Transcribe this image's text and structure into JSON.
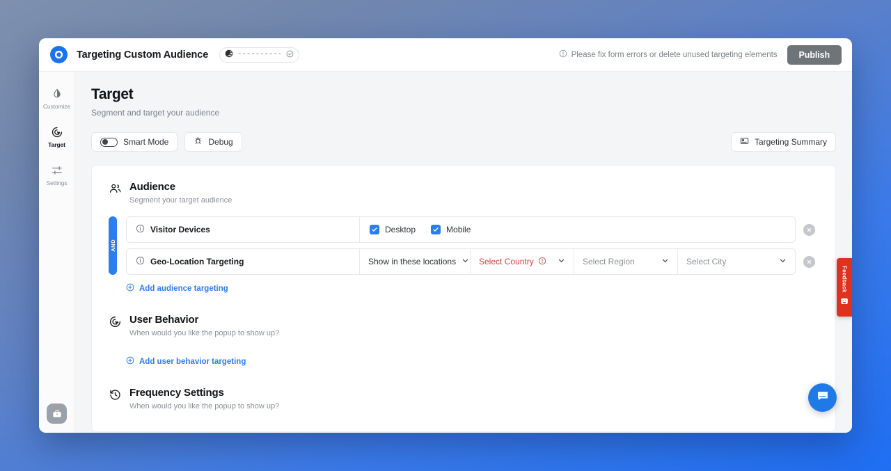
{
  "topbar": {
    "logo_icon": "brand-logo-icon",
    "app_title": "Targeting Custom Audience",
    "status_pill": {
      "globe_icon": "globe-icon",
      "dashes": "----------",
      "check_icon": "check-circle-icon"
    },
    "form_error": {
      "icon": "alert-circle-icon",
      "text": "Please fix form errors or delete unused targeting elements"
    },
    "publish_label": "Publish"
  },
  "sidebar": {
    "items": [
      {
        "label": "Customize",
        "icon": "contrast-droplet-icon",
        "active": false
      },
      {
        "label": "Target",
        "icon": "target-cursor-icon",
        "active": true
      },
      {
        "label": "Settings",
        "icon": "sliders-icon",
        "active": false
      }
    ],
    "bottom_button_icon": "briefcase-icon"
  },
  "page": {
    "title": "Target",
    "subtitle": "Segment and target your audience"
  },
  "toolbar": {
    "smart_mode_label": "Smart Mode",
    "smart_mode_on": false,
    "debug_label": "Debug",
    "debug_icon": "bug-icon",
    "summary_label": "Targeting Summary",
    "summary_icon": "panel-icon"
  },
  "audience": {
    "icon": "users-icon",
    "title": "Audience",
    "subtitle": "Segment your target audience",
    "and_label": "AND",
    "rows": [
      {
        "label": "Visitor Devices",
        "info_icon": "info-icon",
        "type": "checkboxes",
        "checkboxes": [
          {
            "label": "Desktop",
            "checked": true
          },
          {
            "label": "Mobile",
            "checked": true
          }
        ],
        "remove_icon": "remove-circle-icon"
      },
      {
        "label": "Geo-Location Targeting",
        "info_icon": "info-icon",
        "type": "selects",
        "selects": [
          {
            "value": "Show in these locations",
            "state": "value"
          },
          {
            "value": "Select Country",
            "state": "error",
            "error_icon": "alert-circle-icon"
          },
          {
            "value": "Select Region",
            "state": "placeholder"
          },
          {
            "value": "Select City",
            "state": "placeholder"
          }
        ],
        "remove_icon": "remove-circle-icon"
      }
    ],
    "add_link": "Add audience targeting",
    "add_icon": "plus-circle-icon"
  },
  "user_behavior": {
    "icon": "target-cursor-icon",
    "title": "User Behavior",
    "subtitle": "When would you like the popup to show up?",
    "add_link": "Add user behavior targeting",
    "add_icon": "plus-circle-icon"
  },
  "frequency": {
    "icon": "history-clock-icon",
    "title": "Frequency Settings",
    "subtitle": "When would you like the popup to show up?"
  },
  "feedback": {
    "label": "Feedback",
    "icon": "smiley-icon",
    "color": "#e0301e"
  },
  "chat": {
    "icon": "chat-bubble-icon",
    "color": "#1f7ae8"
  },
  "colors": {
    "accent": "#2a7ef0",
    "error": "#e0393e",
    "publish": "#6f7479"
  }
}
